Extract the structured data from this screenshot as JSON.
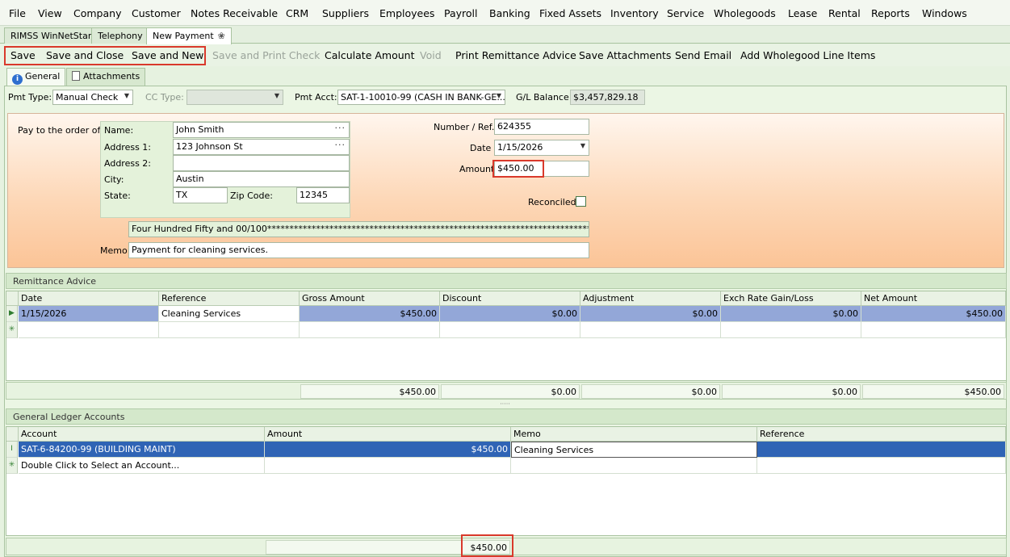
{
  "menu": [
    "File",
    "View",
    "Company",
    "Customer",
    "Notes Receivable",
    "CRM",
    "Suppliers",
    "Employees",
    "Payroll",
    "Banking",
    "Fixed Assets",
    "Inventory",
    "Service",
    "Wholegoods",
    "Lease",
    "Rental",
    "Reports",
    "Windows"
  ],
  "doc_tabs": [
    "RIMSS WinNetStar",
    "Telephony",
    "New Payment"
  ],
  "toolbar": {
    "save": "Save",
    "save_close": "Save and Close",
    "save_new": "Save and New",
    "save_print": "Save and Print Check",
    "calculate": "Calculate Amount",
    "void": "Void",
    "print_remittance": "Print Remittance Advice",
    "save_attachments": "Save Attachments",
    "send_email": "Send Email",
    "add_wholegood": "Add Wholegood Line Items"
  },
  "inner_tabs": [
    "General",
    "Attachments"
  ],
  "header": {
    "pmt_type_label": "Pmt Type:",
    "pmt_type_value": "Manual Check",
    "cc_type_label": "CC Type:",
    "cc_type_value": "",
    "pmt_acct_label": "Pmt Acct:",
    "pmt_acct_value": "SAT-1-10010-99 (CASH IN BANK-GE...",
    "gl_balance_label": "G/L Balance:",
    "gl_balance_value": "$3,457,829.18"
  },
  "payee": {
    "pay_to_label": "Pay to the order of:",
    "name_label": "Name:",
    "name_value": "John Smith",
    "address1_label": "Address 1:",
    "address1_value": "123 Johnson St",
    "address2_label": "Address 2:",
    "address2_value": "",
    "city_label": "City:",
    "city_value": "Austin",
    "state_label": "State:",
    "state_value": "TX",
    "zip_label": "Zip Code:",
    "zip_value": "12345",
    "number_ref_label": "Number / Ref.",
    "number_ref_value": "624355",
    "date_label": "Date",
    "date_value": "1/15/2026",
    "amount_label": "Amount",
    "amount_value": "$450.00",
    "reconciled_label": "Reconciled",
    "amount_words": "Four Hundred Fifty and 00/100*************************************************************************",
    "memo_label": "Memo",
    "memo_value": "Payment for cleaning services."
  },
  "remittance": {
    "title": "Remittance Advice",
    "columns": [
      "Date",
      "Reference",
      "Gross Amount",
      "Discount",
      "Adjustment",
      "Exch Rate Gain/Loss",
      "Net Amount"
    ],
    "row": [
      "1/15/2026",
      "Cleaning Services",
      "$450.00",
      "$0.00",
      "$0.00",
      "$0.00",
      "$450.00"
    ],
    "totals": [
      "$450.00",
      "$0.00",
      "$0.00",
      "$0.00",
      "$450.00"
    ]
  },
  "gl": {
    "title": "General Ledger Accounts",
    "columns": [
      "Account",
      "Amount",
      "Memo",
      "Reference"
    ],
    "row": [
      "SAT-6-84200-99 (BUILDING MAINT)",
      "$450.00",
      "Cleaning Services",
      ""
    ],
    "new_row_hint": "Double Click to Select an Account...",
    "total": "$450.00"
  },
  "icons": {
    "tab_close": "clover-close-icon",
    "info": "info-icon",
    "attachments": "document-icon"
  },
  "colors": {
    "highlight_red": "#d9392b",
    "selected_row_blue": "#2f64b5",
    "selected_row_light": "#93a7d8"
  }
}
